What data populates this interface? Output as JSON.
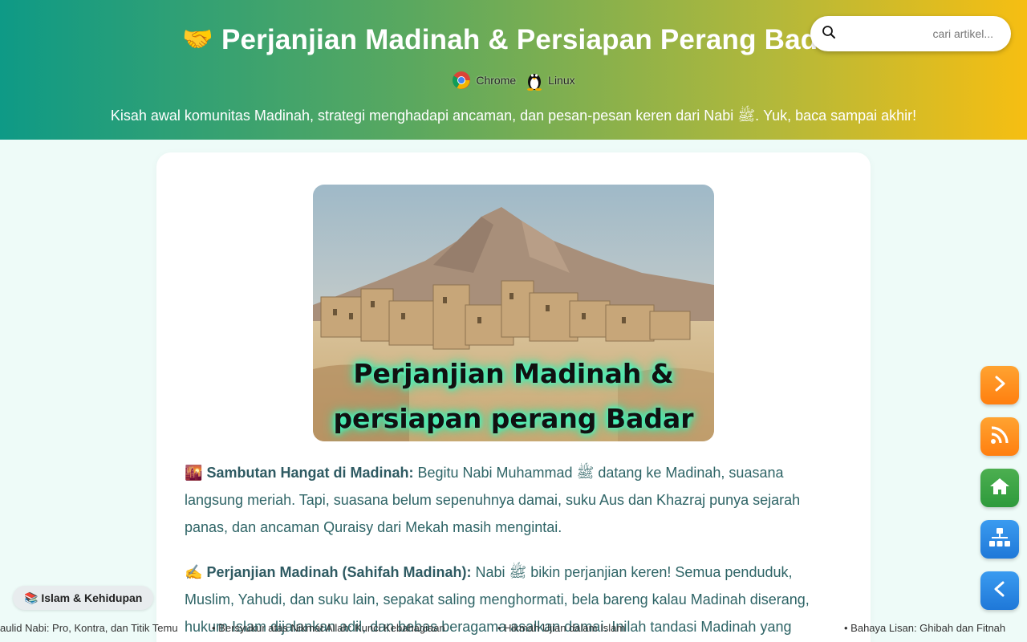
{
  "header": {
    "title_emoji": "🤝",
    "title": "Perjanjian Madinah & Persiapan Perang Badar",
    "platforms": [
      "Chrome",
      "Linux"
    ],
    "subtitle": "Kisah awal komunitas Madinah, strategi menghadapi ancaman, dan pesan-pesan keren dari Nabi ﷺ. Yuk, baca sampai akhir!"
  },
  "search": {
    "placeholder": "cari artikel...",
    "icon": "search-icon"
  },
  "article": {
    "hero_caption_line1": "Perjanjian Madinah &",
    "hero_caption_line2": "persiapan perang Badar",
    "p1_emoji": "🌇",
    "p1_heading": "Sambutan Hangat di Madinah:",
    "p1_text": " Begitu Nabi Muhammad ﷺ datang ke Madinah, suasana langsung meriah. Tapi, suasana belum sepenuhnya damai, suku Aus dan Khazraj punya sejarah panas, dan ancaman Quraisy dari Mekah masih mengintai.",
    "p2_emoji": "✍️",
    "p2_heading": "Perjanjian Madinah (Sahifah Madinah):",
    "p2_text": " Nabi ﷺ bikin perjanjian keren! Semua penduduk, Muslim, Yahudi, dan suku lain, sepakat saling menghormati, bela bareng kalau Madinah diserang, hukum Islam dijalankan adil, dan bebas beragama asalkan damai. Inilah tandasi Madinah yang"
  },
  "category_badge": "📚 Islam & Kehidupan",
  "ticker": [
    "aulid Nabi: Pro, Kontra, dan Titik Temu",
    "• Bersyukur atas Nikmat Allah: Kunci Kebahagiaan",
    "• Hikmah Ujian dalam Islam",
    "• Bahaya Lisan: Ghibah dan Fitnah"
  ],
  "fabs": [
    "next-icon",
    "rss-icon",
    "home-icon",
    "sitemap-icon",
    "back-icon"
  ],
  "colors": {
    "orange": "#ff8c1a",
    "green": "#3fa54a",
    "blue": "#2a87e3",
    "text": "#2e6466"
  }
}
